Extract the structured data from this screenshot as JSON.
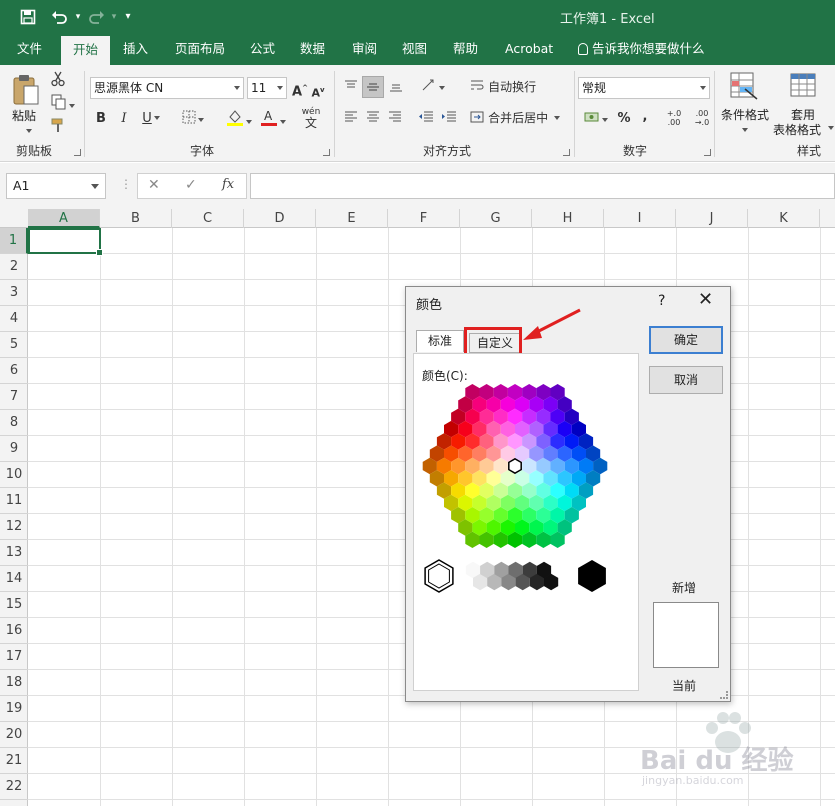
{
  "window": {
    "title": "工作簿1  -  Excel"
  },
  "quick_access": {
    "icons": [
      "save-icon",
      "undo-icon",
      "redo-icon",
      "customize-icon"
    ]
  },
  "tabs": [
    {
      "label": "文件",
      "active": false
    },
    {
      "label": "开始",
      "active": true
    },
    {
      "label": "插入",
      "active": false
    },
    {
      "label": "页面布局",
      "active": false
    },
    {
      "label": "公式",
      "active": false
    },
    {
      "label": "数据",
      "active": false
    },
    {
      "label": "审阅",
      "active": false
    },
    {
      "label": "视图",
      "active": false
    },
    {
      "label": "帮助",
      "active": false
    },
    {
      "label": "Acrobat",
      "active": false
    }
  ],
  "tell_me": "告诉我你想要做什么",
  "ribbon": {
    "clipboard": {
      "paste_label": "粘贴",
      "group_label": "剪贴板"
    },
    "font": {
      "name": "思源黑体 CN",
      "size": "11",
      "group_label": "字体",
      "wen_glyph": "wén",
      "wen_char": "文"
    },
    "alignment": {
      "wrap_label": "自动换行",
      "merge_label": "合并后居中",
      "group_label": "对齐方式"
    },
    "number": {
      "format": "常规",
      "percent": "%",
      "comma": ",",
      "inc_decimal": "+.0 .00",
      "dec_decimal": ".00 →.0",
      "group_label": "数字"
    },
    "styles": {
      "conditional_label": "条件格式",
      "table_label_1": "套用",
      "table_label_2": "表格格式",
      "group_label": "样式"
    }
  },
  "formula_bar": {
    "name_box": "A1",
    "fx": "fx",
    "cancel": "✕",
    "enter": "✓",
    "value": ""
  },
  "grid": {
    "columns": [
      "A",
      "B",
      "C",
      "D",
      "E",
      "F",
      "G",
      "H",
      "I",
      "J",
      "K"
    ],
    "rows": [
      "1",
      "2",
      "3",
      "4",
      "5",
      "6",
      "7",
      "8",
      "9",
      "10",
      "11",
      "12",
      "13",
      "14",
      "15",
      "16",
      "17",
      "18",
      "19",
      "20",
      "21",
      "22"
    ],
    "selected_cell": "A1"
  },
  "dialog": {
    "title": "颜色",
    "help": "?",
    "close": "✕",
    "tabs": [
      "标准",
      "自定义"
    ],
    "colors_label": "颜色(C):",
    "ok": "确定",
    "cancel": "取消",
    "new_label": "新增",
    "current_label": "当前"
  },
  "colors": {
    "excel_green": "#217346",
    "highlight_red": "#e02020",
    "focus_blue": "#3c7fd1"
  },
  "watermark": {
    "text": "Bai du 经验",
    "subtext": "jingyan.baidu.com"
  }
}
